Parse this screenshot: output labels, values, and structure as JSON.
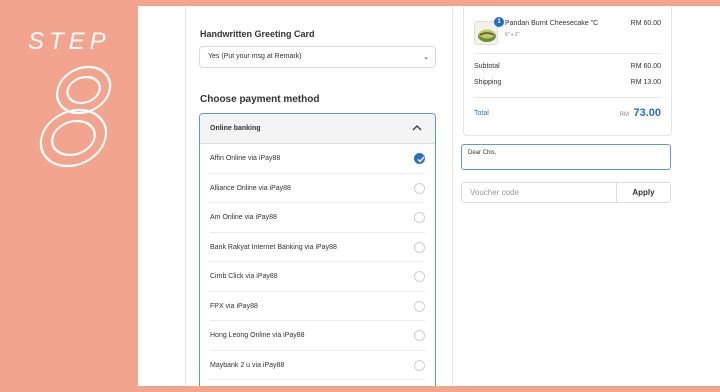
{
  "step": {
    "word": "STEP",
    "number": "8"
  },
  "greeting": {
    "label": "Handwritten Greeting Card",
    "selected": "Yes (Put your msg at Remark)"
  },
  "payment": {
    "title": "Choose payment method",
    "header": "Online banking",
    "methods": [
      {
        "label": "Affin Online via iPay88",
        "checked": true
      },
      {
        "label": "Alliance Online via iPay88",
        "checked": false
      },
      {
        "label": "Am Online via iPay88",
        "checked": false
      },
      {
        "label": "Bank Rakyat Internet Banking via iPay88",
        "checked": false
      },
      {
        "label": "Cimb Click via iPay88",
        "checked": false
      },
      {
        "label": "FPX via iPay88",
        "checked": false
      },
      {
        "label": "Hong Leong Online via iPay88",
        "checked": false
      },
      {
        "label": "Maybank 2 u via iPay88",
        "checked": false
      }
    ]
  },
  "summary": {
    "product": {
      "badge": "1",
      "name": "Pandan Burnt Cheesecake \"C",
      "size": "6\" x 2\"",
      "price": "RM 60.00"
    },
    "subtotal_label": "Subtotal",
    "subtotal_value": "RM 60.00",
    "shipping_label": "Shipping",
    "shipping_value": "RM 13.00",
    "total_label": "Total",
    "total_currency": "RM",
    "total_value": "73.00"
  },
  "remark": {
    "text": "Dear Chis,"
  },
  "voucher": {
    "placeholder": "Voucher code",
    "apply_label": "Apply"
  },
  "colors": {
    "background": "#f2a48e",
    "accent": "#1f6fc2"
  }
}
